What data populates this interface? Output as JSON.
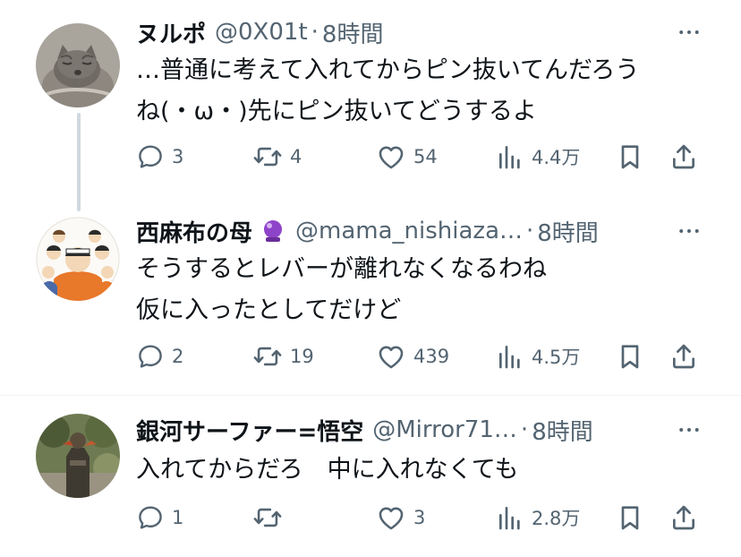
{
  "tweets": [
    {
      "name": "ヌルポ",
      "handle": "@0X01t",
      "separator": "·",
      "time": "8時間",
      "text": "…普通に考えて入れてからピン抜いてんだろう\nね(・ω・)先にピン抜いてどうするよ",
      "replies": "3",
      "retweets": "4",
      "likes": "54",
      "views": "4.4万"
    },
    {
      "name": "西麻布の母",
      "handle": "@mama_nishiaza…",
      "separator": "·",
      "time": "8時間",
      "text": "そうするとレバーが離れなくなるわね\n仮に入ったとしてだけど",
      "replies": "2",
      "retweets": "19",
      "likes": "439",
      "views": "4.5万"
    },
    {
      "name": "銀河サーファー=悟空",
      "handle": "@Mirror71…",
      "separator": "·",
      "time": "8時間",
      "text": "入れてからだろ　中に入れなくても",
      "replies": "1",
      "retweets": "",
      "likes": "3",
      "views": "2.8万"
    }
  ],
  "colors": {
    "text": "#0f1419",
    "secondary": "#536471",
    "thread_line": "#cfd9de",
    "divider": "#eff3f4"
  },
  "icons": [
    "reply-icon",
    "retweet-icon",
    "like-icon",
    "views-icon",
    "bookmark-icon",
    "share-icon",
    "more-icon",
    "crystal-ball-icon"
  ]
}
